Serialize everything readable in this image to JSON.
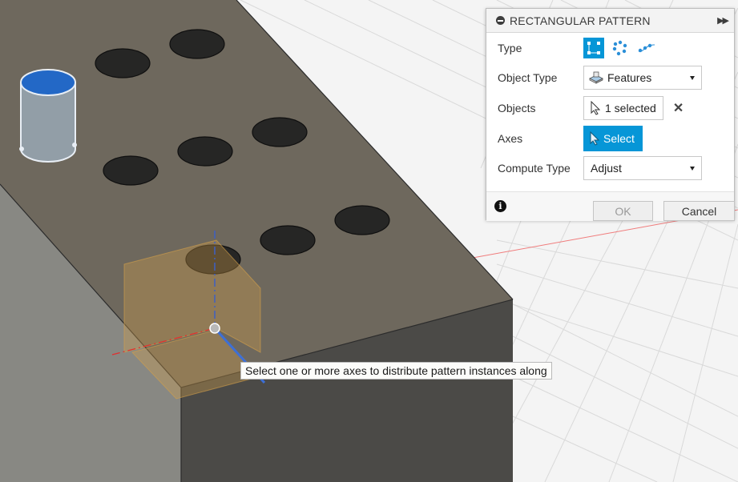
{
  "panel": {
    "title": "RECTANGULAR PATTERN",
    "type_label": "Type",
    "type_options": [
      "rectangular-pattern-icon",
      "circular-pattern-icon",
      "path-pattern-icon"
    ],
    "object_type_label": "Object Type",
    "object_type_value": "Features",
    "objects_label": "Objects",
    "objects_value": "1 selected",
    "axes_label": "Axes",
    "axes_button": "Select",
    "compute_type_label": "Compute Type",
    "compute_type_value": "Adjust",
    "ok_label": "OK",
    "cancel_label": "Cancel"
  },
  "tooltip": "Select one or more axes to distribute pattern instances along",
  "colors": {
    "accent": "#0696d7",
    "block_top": "#6d675c",
    "block_side": "#4b4a47",
    "hole": "#2a2a29",
    "cylinder_cap": "#2368c6",
    "axis_red": "#e03030",
    "axis_blue": "#3d6fd6",
    "plane_orange": "#d4a04a"
  }
}
